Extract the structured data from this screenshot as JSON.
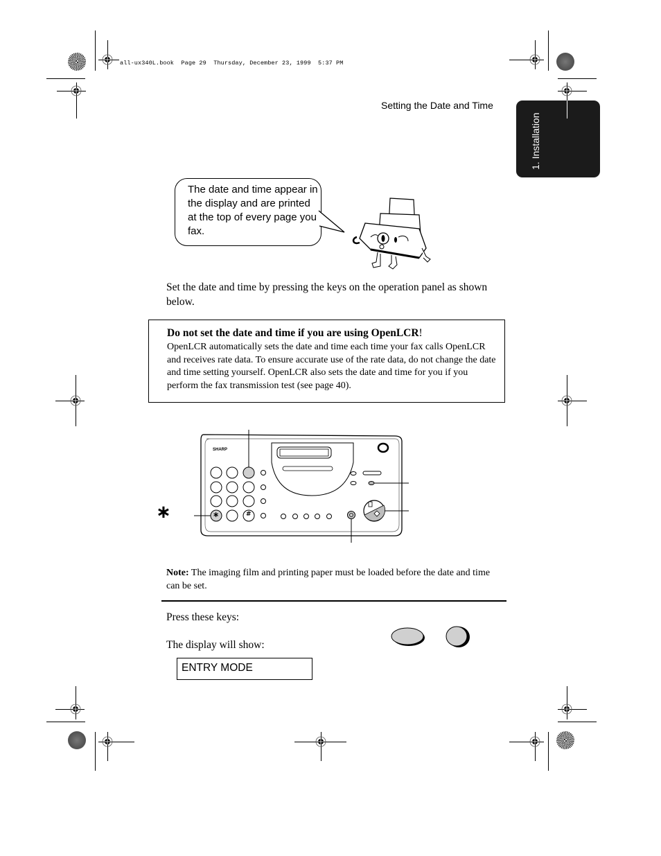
{
  "slug_line": "all-ux340L.book  Page 29  Thursday, December 23, 1999  5:37 PM",
  "running_head": "Setting the Date and Time",
  "section_tab": "1. Installation",
  "speech_bubble": "The date and time appear in the display and are printed at the top of every page you fax.",
  "intro_paragraph": "Set the date and time by pressing the keys on the operation panel as shown below.",
  "callout": {
    "title": "Do not set the date and time if you are using OpenLCR",
    "title_suffix": "!",
    "body": "OpenLCR automatically sets the date and time each time your fax calls OpenLCR and receives rate data. To ensure accurate use of the rate data, do not change the date and time setting yourself. OpenLCR also sets the date and time for you if you perform the fax transmission test (see page 40)."
  },
  "panel": {
    "brand": "SHARP",
    "star_marker": "∗",
    "star_key": "∗",
    "hash_key": "#"
  },
  "note": {
    "label": "Note:",
    "text": " The imaging film and printing paper must be loaded before the date and time can be set."
  },
  "steps": {
    "press_keys_label": "Press these keys:",
    "display_label": "The display will show:",
    "display_value": "ENTRY MODE"
  },
  "icons": {
    "registration_mark": "crosshair-target-icon",
    "color_wheel": "print-color-wheel-icon",
    "fax_mascot": "fax-machine-mascot-illustration",
    "key_function": "oval-key-icon",
    "key_round": "round-key-icon"
  }
}
